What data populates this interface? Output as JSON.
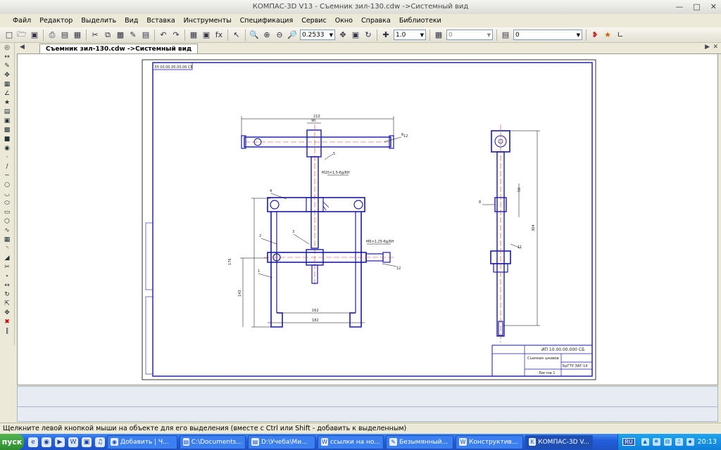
{
  "window": {
    "title": "КОМПАС-3D V13 - Съемник зил-130.cdw ->Системный вид"
  },
  "menu": [
    "Файл",
    "Редактор",
    "Выделить",
    "Вид",
    "Вставка",
    "Инструменты",
    "Спецификация",
    "Сервис",
    "Окно",
    "Справка",
    "Библиотеки"
  ],
  "toolbar": {
    "zoom_value": "0.2533",
    "step_value": "1.0",
    "layer_value": "0",
    "style_value": "0"
  },
  "tab": {
    "label": "Съемник зил-130.cdw ->Системный вид"
  },
  "drawing": {
    "frame_code": "ЭЗ 00.00.00.00.00 СБ",
    "dims": [
      "210",
      "90",
      "12",
      "5",
      "4",
      "3",
      "2",
      "1",
      "176",
      "143",
      "162",
      "182",
      "6",
      "11",
      "8",
      "12",
      "50",
      "304"
    ],
    "thread_note1": "М20×1,5-6g/6H",
    "thread_note2": "М6×1,25-6g/6H",
    "titleblock": {
      "code": "ИП 10.00.00.000 СБ",
      "name": "Съемник шкивов",
      "sheet": "Листов 1",
      "org": "БрГТУ ЭАТ-14"
    }
  },
  "status": {
    "text": "Щелкните левой кнопкой мыши на объекте для его выделения (вместе с Ctrl или Shift - добавить к выделенным)"
  },
  "taskbar": {
    "start_label": "пуск",
    "tasks": [
      "Добавить | Ч...",
      "C:\\Documents...",
      "D:\\Учеба\\Ми...",
      "ссылки на но...",
      "Безымянный...",
      "Конструктив...",
      "КОМПАС-3D V..."
    ],
    "lang": "RU",
    "clock": "20:13"
  }
}
